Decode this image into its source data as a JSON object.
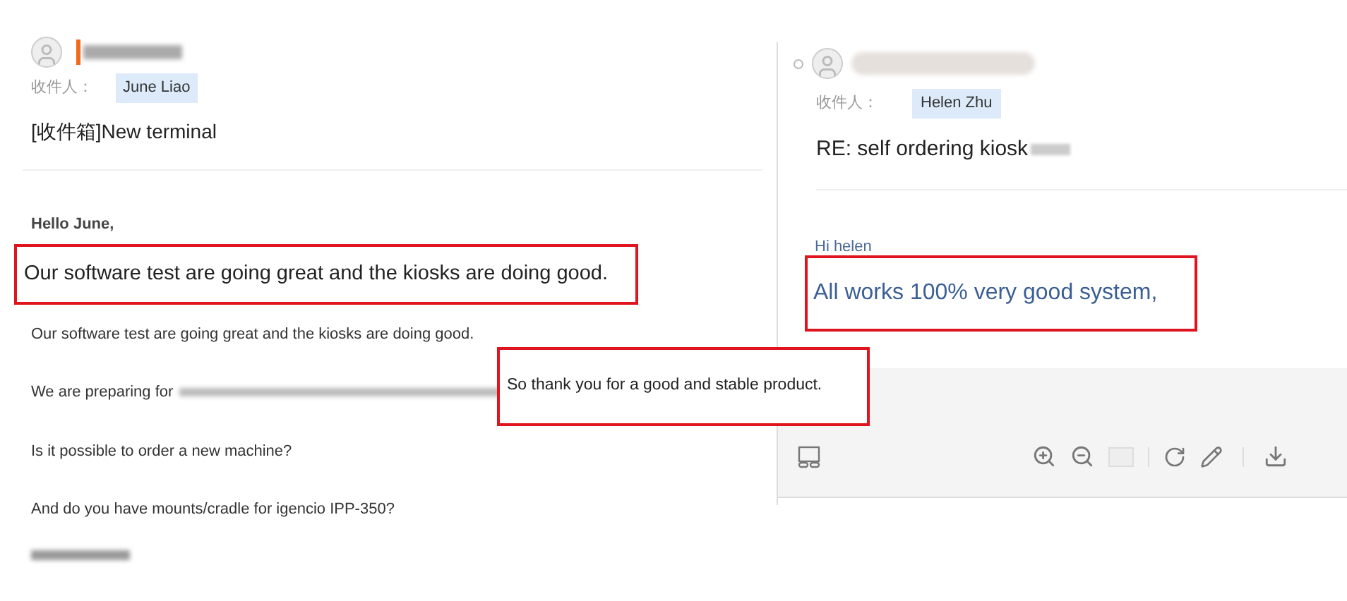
{
  "left_email": {
    "recipient_label": "收件人：",
    "recipient": "June Liao",
    "subject": "[收件箱]New terminal",
    "greeting": "Hello June,",
    "highlight": "Our software test are going great and the kiosks are doing good.",
    "lines": [
      "Our software test are going great and the kiosks are doing good.",
      "We are preparing for",
      "Is it possible to order a new machine?",
      "And do you have mounts/cradle for igencio IPP-350?"
    ]
  },
  "right_email": {
    "recipient_label": "收件人：",
    "recipient": "Helen Zhu",
    "subject": "RE: self ordering kiosk",
    "greeting": "Hi helen",
    "highlight": "All works 100% very good system,"
  },
  "callout": "So thank you for a good and stable product."
}
